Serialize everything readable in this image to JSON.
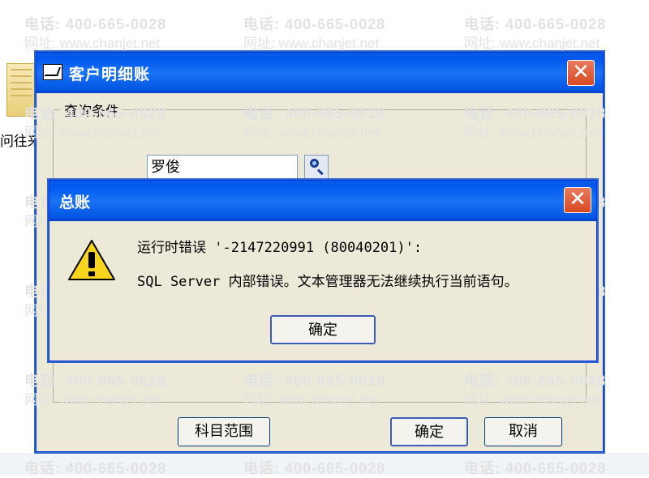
{
  "desktop": {
    "icon_label": "问往来"
  },
  "window": {
    "title": "客户明细账",
    "close_glyph": "✕",
    "query_group_label": "查询条件",
    "search_value": "罗俊",
    "buttons": {
      "scope": "科目范围",
      "ok": "确定",
      "cancel": "取消"
    }
  },
  "dialog": {
    "title": "总账",
    "close_glyph": "✕",
    "message_line1": "运行时错误 '-2147220991 (80040201)':",
    "message_line2": "SQL Server 内部错误。文本管理器无法继续执行当前语句。",
    "ok_label": "确定",
    "icon": "warning-icon"
  },
  "watermark": {
    "phone": "电话: 400-665-0028",
    "site": "网址: www.chanjet.net"
  },
  "colors": {
    "titlebar": "#0058ee",
    "close": "#d84a22",
    "face": "#ece9d8"
  }
}
